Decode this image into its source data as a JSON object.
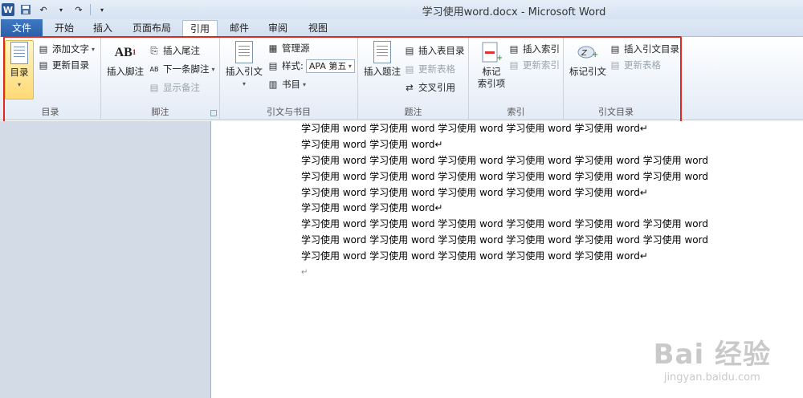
{
  "window": {
    "title": "学习使用word.docx - Microsoft Word"
  },
  "qat": {
    "app_icon": "W",
    "save_icon": "save-icon",
    "undo_icon": "undo-icon",
    "redo_icon": "redo-icon"
  },
  "tabs": [
    {
      "label": "文件"
    },
    {
      "label": "开始"
    },
    {
      "label": "插入"
    },
    {
      "label": "页面布局"
    },
    {
      "label": "引用"
    },
    {
      "label": "邮件"
    },
    {
      "label": "审阅"
    },
    {
      "label": "视图"
    }
  ],
  "ribbon": {
    "toc": {
      "big": "目录",
      "add_text": "添加文字",
      "update": "更新目录",
      "label": "目录"
    },
    "footnote": {
      "big": "插入脚注",
      "insert_endnote": "插入尾注",
      "next_footnote": "下一条脚注",
      "show_notes": "显示备注",
      "label": "脚注"
    },
    "citation": {
      "big": "插入引文",
      "manage_sources": "管理源",
      "style_label": "样式:",
      "style_value": "APA 第五",
      "bibliography": "书目",
      "label": "引文与书目"
    },
    "caption": {
      "big": "插入题注",
      "insert_table_of_figures": "插入表目录",
      "update_table": "更新表格",
      "cross_reference": "交叉引用",
      "label": "题注"
    },
    "index": {
      "big_line1": "标记",
      "big_line2": "索引项",
      "insert_index": "插入索引",
      "update_index": "更新索引",
      "label": "索引"
    },
    "toa": {
      "big": "标记引文",
      "insert_toa": "插入引文目录",
      "update_table": "更新表格",
      "label": "引文目录"
    }
  },
  "document": {
    "lines": [
      "学习使用 word 学习使用 word 学习使用 word 学习使用 word 学习使用 word↵",
      "学习使用 word 学习使用 word↵",
      "学习使用 word 学习使用 word 学习使用 word 学习使用 word 学习使用 word 学习使用 word",
      "学习使用 word 学习使用 word 学习使用 word 学习使用 word 学习使用 word 学习使用 word",
      "学习使用 word 学习使用 word 学习使用 word 学习使用 word 学习使用 word↵",
      "学习使用 word 学习使用 word↵",
      "学习使用 word 学习使用 word 学习使用 word 学习使用 word 学习使用 word 学习使用 word",
      "学习使用 word 学习使用 word 学习使用 word 学习使用 word 学习使用 word 学习使用 word",
      "学习使用 word 学习使用 word 学习使用 word 学习使用 word 学习使用 word↵",
      "↵"
    ]
  },
  "watermark": {
    "main": "Bai 经验",
    "sub": "jingyan.baidu.com"
  },
  "colors": {
    "highlight": "#e0281f",
    "file_tab": "#2a5fa8"
  }
}
